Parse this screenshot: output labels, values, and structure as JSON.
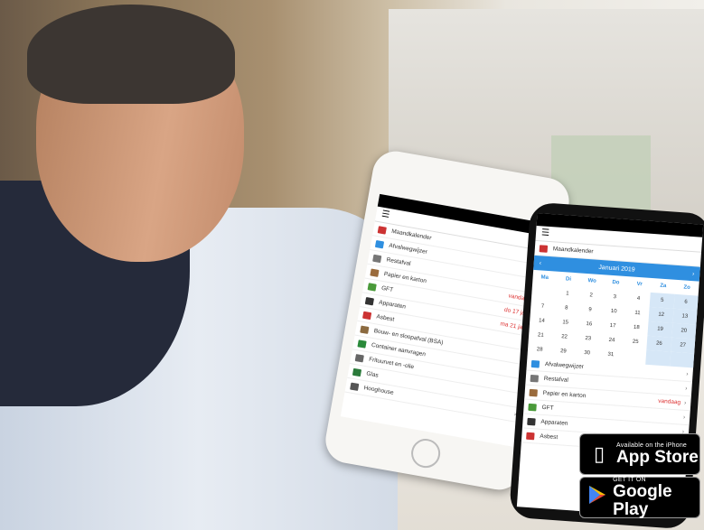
{
  "phone_white": {
    "rows": [
      {
        "label": "Maandkalender",
        "date": "",
        "color": "#c33"
      },
      {
        "label": "Afvalwegwijzer",
        "date": "",
        "color": "#2f8fe0"
      },
      {
        "label": "Restafval",
        "date": "",
        "color": "#777"
      },
      {
        "label": "Papier en karton",
        "date": "vandaag",
        "color": "#9a6b3c"
      },
      {
        "label": "GFT",
        "date": "do 17 jan",
        "color": "#4a9a3a"
      },
      {
        "label": "Apparaten",
        "date": "ma 21 jan",
        "color": "#333"
      },
      {
        "label": "Asbest",
        "date": "",
        "color": "#c33"
      },
      {
        "label": "Bouw- en sloopafval (BSA)",
        "date": "",
        "color": "#8b6a40"
      },
      {
        "label": "Container aanvragen",
        "date": "",
        "color": "#2a8a3a"
      },
      {
        "label": "Frituurvet en -olie",
        "date": "",
        "color": "#666"
      },
      {
        "label": "Glas",
        "date": "",
        "color": "#2a7a3a"
      },
      {
        "label": "Hooghouse",
        "date": "",
        "color": "#555"
      }
    ]
  },
  "phone_dark": {
    "title": "Maandkalender",
    "month": "Januari 2019",
    "days_of_week": [
      "Ma",
      "Di",
      "Wo",
      "Do",
      "Vr",
      "Za",
      "Zo"
    ],
    "days": [
      "",
      "1",
      "2",
      "3",
      "4",
      "5",
      "6",
      "7",
      "8",
      "9",
      "10",
      "11",
      "12",
      "13",
      "14",
      "15",
      "16",
      "17",
      "18",
      "19",
      "20",
      "21",
      "22",
      "23",
      "24",
      "25",
      "26",
      "27",
      "28",
      "29",
      "30",
      "31",
      "",
      "",
      ""
    ],
    "rows": [
      {
        "label": "Afvalwegwijzer",
        "date": "",
        "color": "#2f8fe0"
      },
      {
        "label": "Restafval",
        "date": "",
        "color": "#777"
      },
      {
        "label": "Papier en karton",
        "date": "vandaag",
        "color": "#9a6b3c"
      },
      {
        "label": "GFT",
        "date": "",
        "color": "#4a9a3a"
      },
      {
        "label": "Apparaten",
        "date": "",
        "color": "#333"
      },
      {
        "label": "Asbest",
        "date": "",
        "color": "#c33"
      }
    ]
  },
  "badges": {
    "appstore_small": "Available on the iPhone",
    "appstore_big": "App Store",
    "googleplay_small": "GET IT ON",
    "googleplay_big": "Google Play"
  }
}
